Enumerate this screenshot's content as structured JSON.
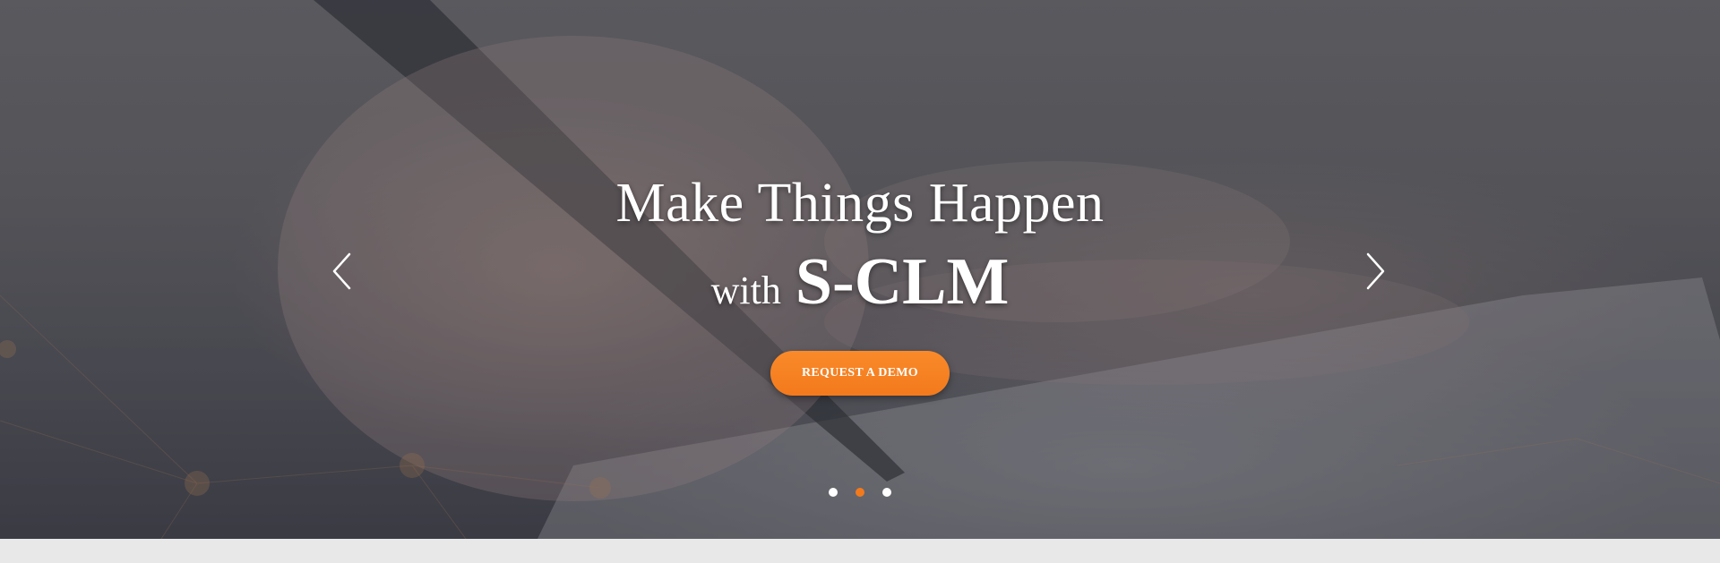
{
  "hero": {
    "headline_line1": "Make Things Happen",
    "headline_with": "with",
    "headline_brand": "S-CLM",
    "cta_label": "REQUEST A DEMO",
    "prev_icon": "chevron-left-icon",
    "next_icon": "chevron-right-icon",
    "slides": {
      "count": 3,
      "active_index": 1
    }
  },
  "colors": {
    "accent": "#f37a1c",
    "text": "#ffffff",
    "below_band": "#e8e8e8"
  }
}
